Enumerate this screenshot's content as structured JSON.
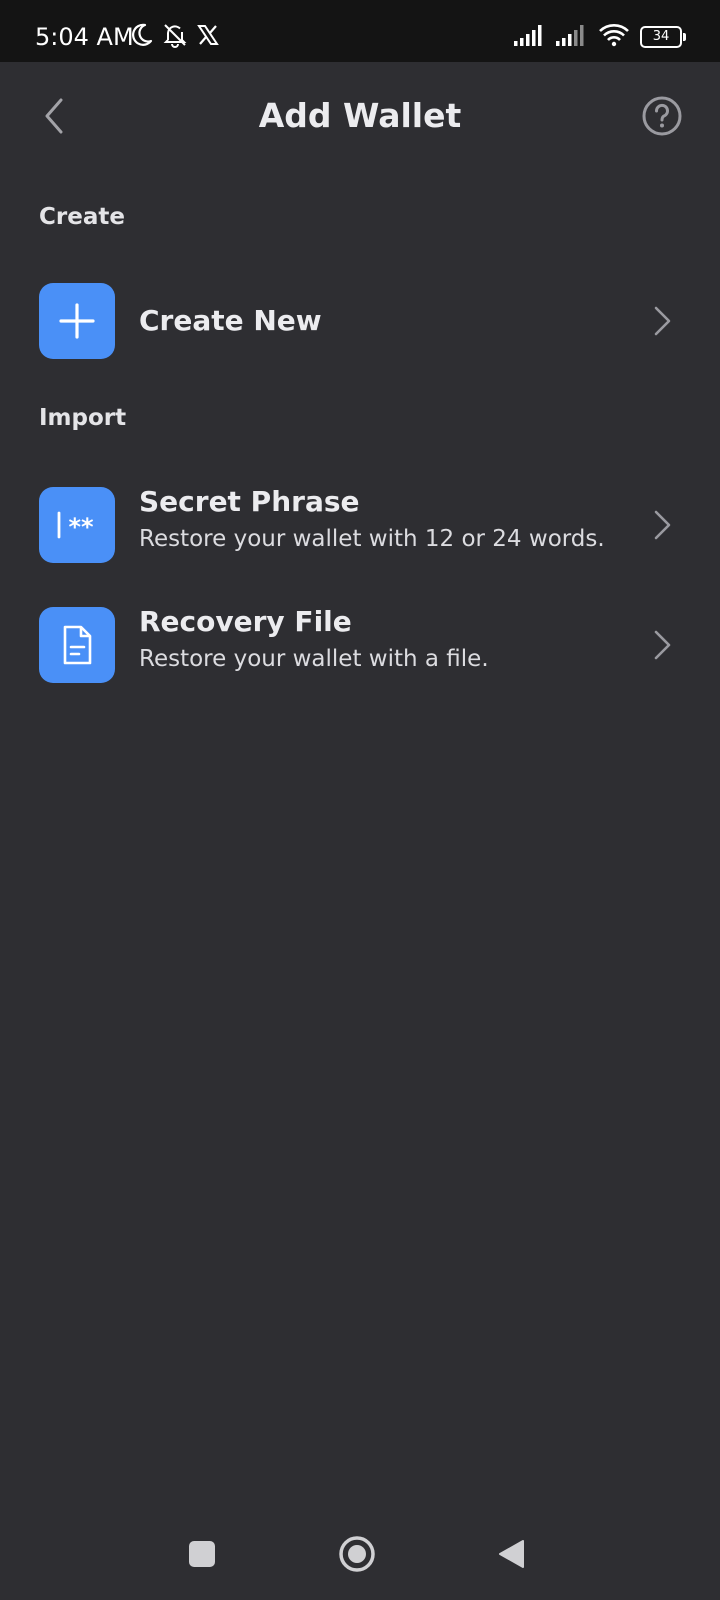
{
  "status_bar": {
    "time": "5:04 AM",
    "battery": "34",
    "left_icons": [
      "moon-icon",
      "bell-off-icon",
      "x-logo-icon"
    ],
    "right_icons": [
      "signal-icon",
      "signal-icon",
      "wifi-icon",
      "battery-icon"
    ]
  },
  "header": {
    "title": "Add Wallet",
    "back_icon": "chevron-left-icon",
    "help_icon": "help-circle-icon"
  },
  "sections": {
    "create": {
      "title": "Create",
      "items": [
        {
          "title": "Create New",
          "icon": "plus-icon"
        }
      ]
    },
    "import": {
      "title": "Import",
      "items": [
        {
          "title": "Secret Phrase",
          "subtitle": "Restore your wallet with 12 or 24 words.",
          "icon": "secret-phrase-icon"
        },
        {
          "title": "Recovery File",
          "subtitle": "Restore your wallet with a file.",
          "icon": "file-icon"
        }
      ]
    }
  },
  "nav_bar": {
    "buttons": [
      "recents-icon",
      "home-icon",
      "back-icon"
    ]
  },
  "colors": {
    "background": "#2e2e32",
    "status_bar": "#141414",
    "accent": "#4a90f7",
    "text": "#ececef",
    "muted_icon": "#9a9aa0"
  }
}
